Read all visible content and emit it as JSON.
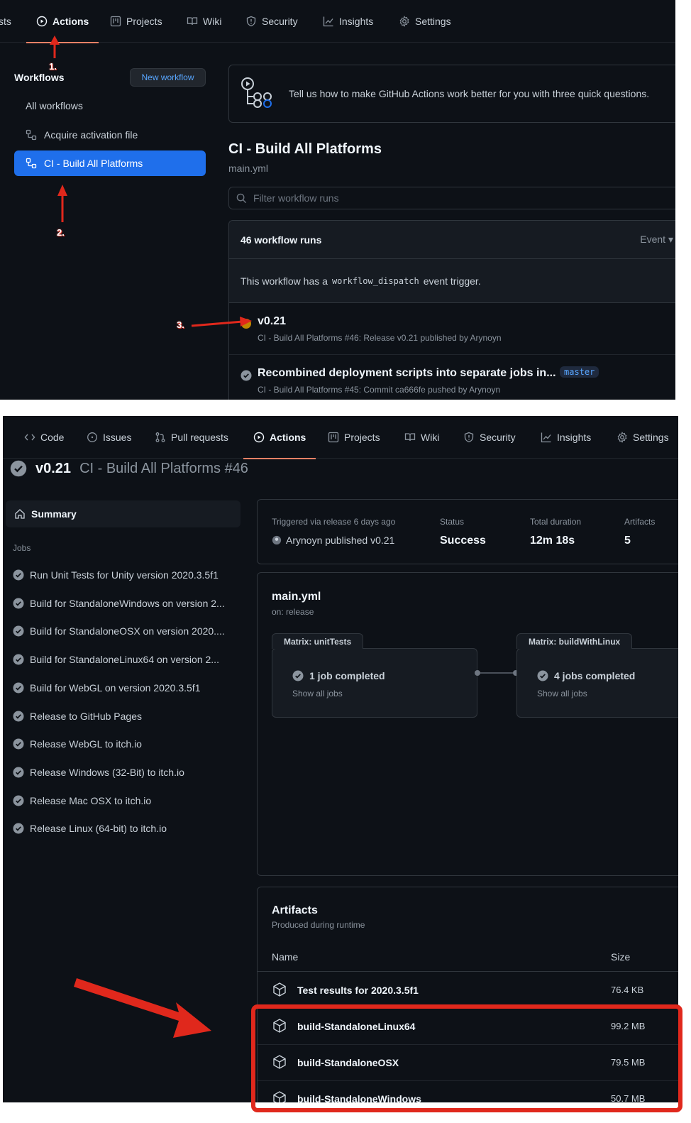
{
  "colors": {
    "accent_blue": "#1f6feb",
    "link_blue": "#58a6ff",
    "success": "#8b949e",
    "annotation_red": "#e0281c"
  },
  "top": {
    "tabs": [
      {
        "label": "sts",
        "icon": "none"
      },
      {
        "label": "Actions",
        "icon": "play-icon",
        "active": true
      },
      {
        "label": "Projects",
        "icon": "project-icon"
      },
      {
        "label": "Wiki",
        "icon": "book-icon"
      },
      {
        "label": "Security",
        "icon": "shield-icon"
      },
      {
        "label": "Insights",
        "icon": "graph-icon"
      },
      {
        "label": "Settings",
        "icon": "gear-icon"
      }
    ],
    "sidebar": {
      "title": "Workflows",
      "new_workflow": "New workflow",
      "items": [
        {
          "label": "All workflows"
        },
        {
          "label": "Acquire activation file",
          "icon": "workflow-icon"
        },
        {
          "label": "CI - Build All Platforms",
          "icon": "workflow-icon",
          "active": true
        }
      ]
    },
    "survey_text": "Tell us how to make GitHub Actions work better for you with three quick questions.",
    "workflow_title": "CI - Build All Platforms",
    "workflow_file": "main.yml",
    "filter_placeholder": "Filter workflow runs",
    "runs_count": "46 workflow runs",
    "event_label": "Event",
    "dispatch_before": "This workflow has a",
    "dispatch_code": "workflow_dispatch",
    "dispatch_after": "event trigger.",
    "runs": [
      {
        "title": "v0.21",
        "meta": "CI - Build All Platforms #46: Release v0.21 published by Arynoyn",
        "status": "in-progress"
      },
      {
        "title": "Recombined deployment scripts into separate jobs in...",
        "meta": "CI - Build All Platforms #45: Commit ca666fe pushed by Arynoyn",
        "branch": "master",
        "status": "success"
      }
    ]
  },
  "bottom": {
    "tabs": [
      {
        "label": "Code",
        "icon": "code-icon"
      },
      {
        "label": "Issues",
        "icon": "issue-icon"
      },
      {
        "label": "Pull requests",
        "icon": "pull-request-icon"
      },
      {
        "label": "Actions",
        "icon": "play-icon",
        "active": true
      },
      {
        "label": "Projects",
        "icon": "project-icon"
      },
      {
        "label": "Wiki",
        "icon": "book-icon"
      },
      {
        "label": "Security",
        "icon": "shield-icon"
      },
      {
        "label": "Insights",
        "icon": "graph-icon"
      },
      {
        "label": "Settings",
        "icon": "gear-icon"
      }
    ],
    "run_version": "v0.21",
    "run_name": "CI - Build All Platforms #46",
    "summary_label": "Summary",
    "jobs_label": "Jobs",
    "jobs": [
      "Run Unit Tests for Unity version 2020.3.5f1",
      "Build for StandaloneWindows on version 2...",
      "Build for StandaloneOSX on version 2020....",
      "Build for StandaloneLinux64 on version 2...",
      "Build for WebGL on version 2020.3.5f1",
      "Release to GitHub Pages",
      "Release WebGL to itch.io",
      "Release Windows (32-Bit) to itch.io",
      "Release Mac OSX to itch.io",
      "Release Linux (64-bit) to itch.io"
    ],
    "stats": {
      "trigger_label": "Triggered via release 6 days ago",
      "trigger_value": "Arynoyn published v0.21",
      "status_label": "Status",
      "status_value": "Success",
      "duration_label": "Total duration",
      "duration_value": "12m 18s",
      "artifacts_label": "Artifacts",
      "artifacts_value": "5"
    },
    "graph": {
      "file": "main.yml",
      "on": "on: release",
      "matrices": [
        {
          "tab": "Matrix: unitTests",
          "done": "1 job completed",
          "show": "Show all jobs"
        },
        {
          "tab": "Matrix: buildWithLinux",
          "done": "4 jobs completed",
          "show": "Show all jobs"
        }
      ]
    },
    "artifacts": {
      "title": "Artifacts",
      "subtitle": "Produced during runtime",
      "col_name": "Name",
      "col_size": "Size",
      "rows": [
        {
          "name": "Test results for 2020.3.5f1",
          "size": "76.4 KB"
        },
        {
          "name": "build-StandaloneLinux64",
          "size": "99.2 MB"
        },
        {
          "name": "build-StandaloneOSX",
          "size": "79.5 MB"
        },
        {
          "name": "build-StandaloneWindows",
          "size": "50.7 MB"
        }
      ]
    }
  },
  "annotations": {
    "step1": "1.",
    "step2": "2.",
    "step3": "3."
  }
}
